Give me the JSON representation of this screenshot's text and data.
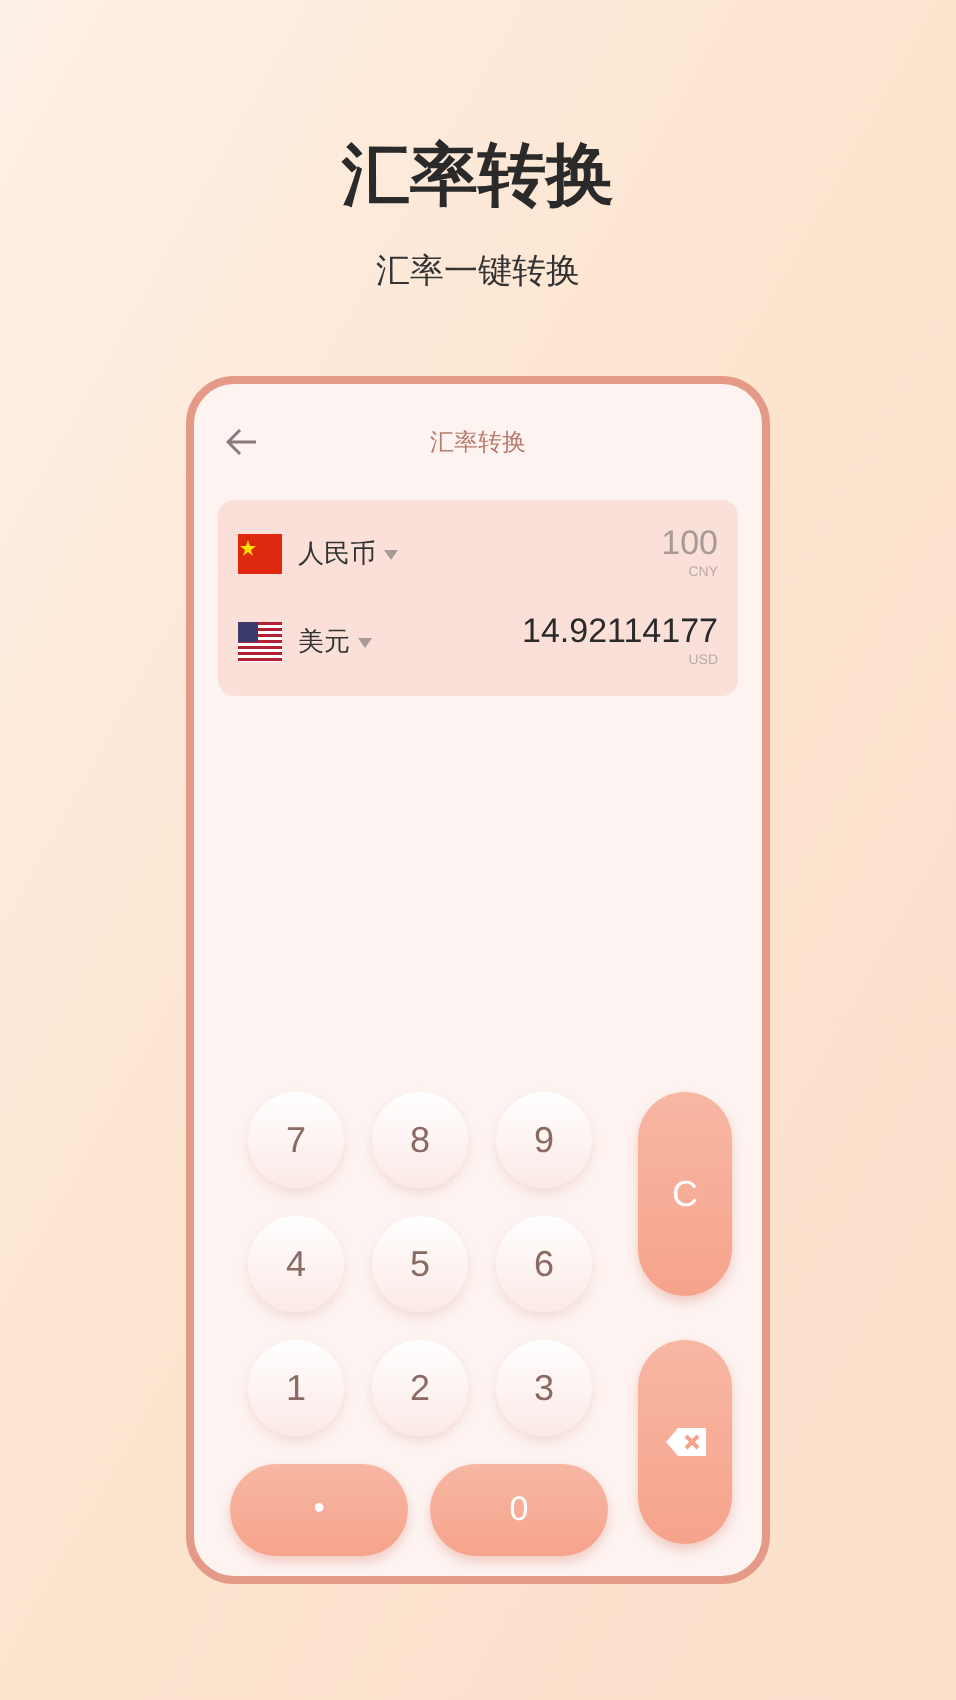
{
  "header": {
    "title": "汇率转换",
    "subtitle": "汇率一键转换"
  },
  "screen": {
    "title": "汇率转换"
  },
  "currencies": [
    {
      "kind": "cn",
      "name": "人民币",
      "amount": "100",
      "code": "CNY",
      "selected": false
    },
    {
      "kind": "us",
      "name": "美元",
      "amount": "14.92114177",
      "code": "USD",
      "selected": true
    }
  ],
  "keypad": {
    "digit_rows": [
      [
        "7",
        "8",
        "9"
      ],
      [
        "4",
        "5",
        "6"
      ],
      [
        "1",
        "2",
        "3"
      ]
    ],
    "dot": "•",
    "zero": "0",
    "clear": "C"
  }
}
